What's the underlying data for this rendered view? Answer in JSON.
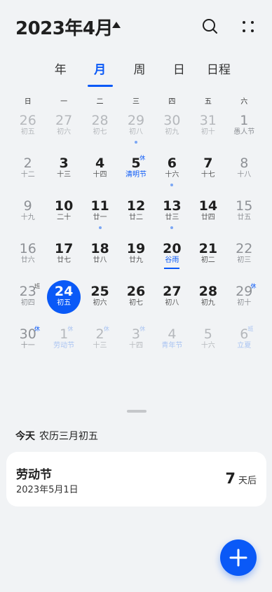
{
  "header": {
    "title": "2023年4月",
    "search_icon": "search-icon",
    "more_icon": "more-icon"
  },
  "tabs": [
    {
      "label": "年",
      "active": false
    },
    {
      "label": "月",
      "active": true
    },
    {
      "label": "周",
      "active": false
    },
    {
      "label": "日",
      "active": false
    },
    {
      "label": "日程",
      "active": false
    }
  ],
  "weekdays": [
    "日",
    "一",
    "二",
    "三",
    "四",
    "五",
    "六"
  ],
  "weeks": [
    [
      {
        "d": "26",
        "l": "初五",
        "dim": true
      },
      {
        "d": "27",
        "l": "初六",
        "dim": true
      },
      {
        "d": "28",
        "l": "初七",
        "dim": true
      },
      {
        "d": "29",
        "l": "初八",
        "dim": true,
        "dot": true
      },
      {
        "d": "30",
        "l": "初九",
        "dim": true
      },
      {
        "d": "31",
        "l": "初十",
        "dim": true
      },
      {
        "d": "1",
        "l": "愚人节",
        "fest": true,
        "weekend": true
      }
    ],
    [
      {
        "d": "2",
        "l": "十二",
        "weekend": true
      },
      {
        "d": "3",
        "l": "十三"
      },
      {
        "d": "4",
        "l": "十四"
      },
      {
        "d": "5",
        "l": "清明节",
        "fest": true,
        "badge": "休"
      },
      {
        "d": "6",
        "l": "十六",
        "dot": true
      },
      {
        "d": "7",
        "l": "十七"
      },
      {
        "d": "8",
        "l": "十八",
        "weekend": true
      }
    ],
    [
      {
        "d": "9",
        "l": "十九",
        "weekend": true
      },
      {
        "d": "10",
        "l": "二十"
      },
      {
        "d": "11",
        "l": "廿一",
        "dot": true
      },
      {
        "d": "12",
        "l": "廿二"
      },
      {
        "d": "13",
        "l": "廿三",
        "dot": true
      },
      {
        "d": "14",
        "l": "廿四"
      },
      {
        "d": "15",
        "l": "廿五",
        "weekend": true
      }
    ],
    [
      {
        "d": "16",
        "l": "廿六",
        "weekend": true
      },
      {
        "d": "17",
        "l": "廿七"
      },
      {
        "d": "18",
        "l": "廿八"
      },
      {
        "d": "19",
        "l": "廿九"
      },
      {
        "d": "20",
        "l": "谷雨",
        "fest": true,
        "underline": true
      },
      {
        "d": "21",
        "l": "初二"
      },
      {
        "d": "22",
        "l": "初三",
        "weekend": true
      }
    ],
    [
      {
        "d": "23",
        "l": "初四",
        "weekend": true,
        "badge": "班",
        "badge_work": true
      },
      {
        "d": "24",
        "l": "初五",
        "today": true
      },
      {
        "d": "25",
        "l": "初六"
      },
      {
        "d": "26",
        "l": "初七"
      },
      {
        "d": "27",
        "l": "初八"
      },
      {
        "d": "28",
        "l": "初九"
      },
      {
        "d": "29",
        "l": "初十",
        "weekend": true,
        "badge": "休"
      }
    ],
    [
      {
        "d": "30",
        "l": "十一",
        "weekend": true,
        "badge": "休"
      },
      {
        "d": "1",
        "l": "劳动节",
        "dim": true,
        "fest": true,
        "badge": "休"
      },
      {
        "d": "2",
        "l": "十三",
        "dim": true,
        "badge": "休"
      },
      {
        "d": "3",
        "l": "十四",
        "dim": true,
        "badge": "休"
      },
      {
        "d": "4",
        "l": "青年节",
        "dim": true,
        "fest": true
      },
      {
        "d": "5",
        "l": "十六",
        "dim": true
      },
      {
        "d": "6",
        "l": "立夏",
        "dim": true,
        "fest": true,
        "badge": "班",
        "badge_work": true
      }
    ]
  ],
  "today_info": {
    "label": "今天",
    "lunar": "农历三月初五"
  },
  "event": {
    "name": "劳动节",
    "date": "2023年5月1日",
    "count": "7",
    "unit": "天后"
  },
  "fab_icon": "add-icon"
}
